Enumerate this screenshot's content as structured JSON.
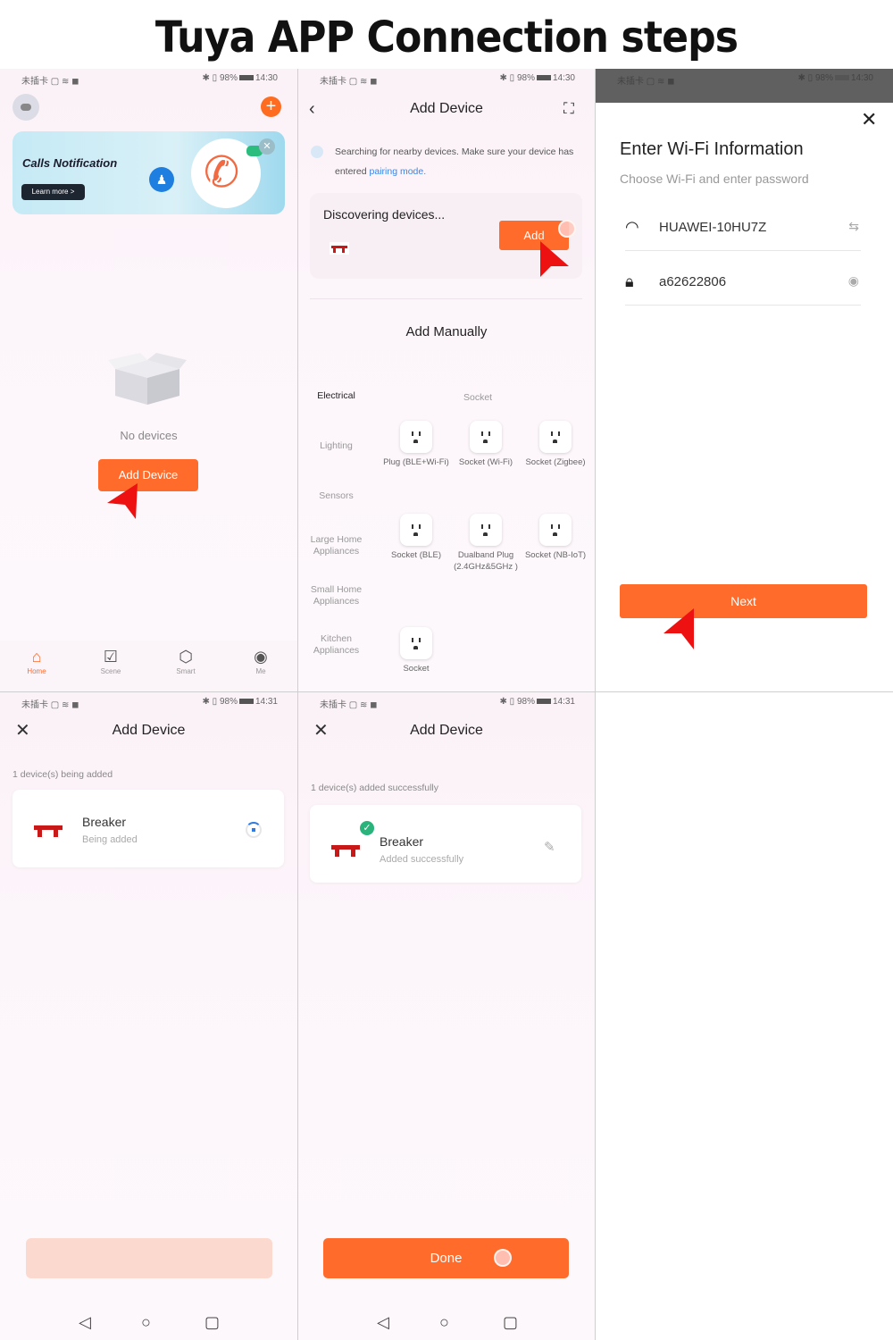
{
  "title": "Tuya APP Connection steps",
  "colors": {
    "accent": "#ff6b2a",
    "arrow": "#ee1111",
    "success": "#2ab37a",
    "link": "#3b86e4"
  },
  "status_bar": {
    "carrier": "未插卡",
    "battery": "98%",
    "time_a": "14:30",
    "time_b": "14:31"
  },
  "home": {
    "banner_title": "Calls Notification",
    "banner_button": "Learn more >",
    "empty_text": "No devices",
    "add_device_button": "Add Device",
    "tabs": [
      {
        "label": "Home",
        "icon": "home-icon"
      },
      {
        "label": "Scene",
        "icon": "check-square-icon"
      },
      {
        "label": "Smart",
        "icon": "cube-icon"
      },
      {
        "label": "Me",
        "icon": "person-icon"
      }
    ]
  },
  "add_device": {
    "title": "Add Device",
    "search_text": "Searching for nearby devices. Make sure your device has entered ",
    "search_link": "pairing mode.",
    "discovering": "Discovering devices...",
    "add_button": "Add",
    "add_manually": "Add Manually",
    "categories": [
      "Electrical",
      "Lighting",
      "Sensors",
      "Large Home Appliances",
      "Small Home Appliances",
      "Kitchen Appliances"
    ],
    "subheading": "Socket",
    "items": [
      "Plug (BLE+Wi-Fi)",
      "Socket (Wi-Fi)",
      "Socket (Zigbee)",
      "Socket (BLE)",
      "Dualband Plug (2.4GHz&5GHz )",
      "Socket (NB-IoT)",
      "Socket"
    ]
  },
  "wifi": {
    "title": "Enter Wi-Fi Information",
    "subtitle": "Choose Wi-Fi and enter password",
    "ssid": "HUAWEI-10HU7Z",
    "password": "a62622806",
    "next_button": "Next"
  },
  "adding": {
    "title": "Add Device",
    "note": "1 device(s) being added",
    "device_name": "Breaker",
    "device_status": "Being added"
  },
  "done": {
    "title": "Add Device",
    "note": "1 device(s) added successfully",
    "device_name": "Breaker",
    "device_status": "Added successfully",
    "done_button": "Done"
  }
}
